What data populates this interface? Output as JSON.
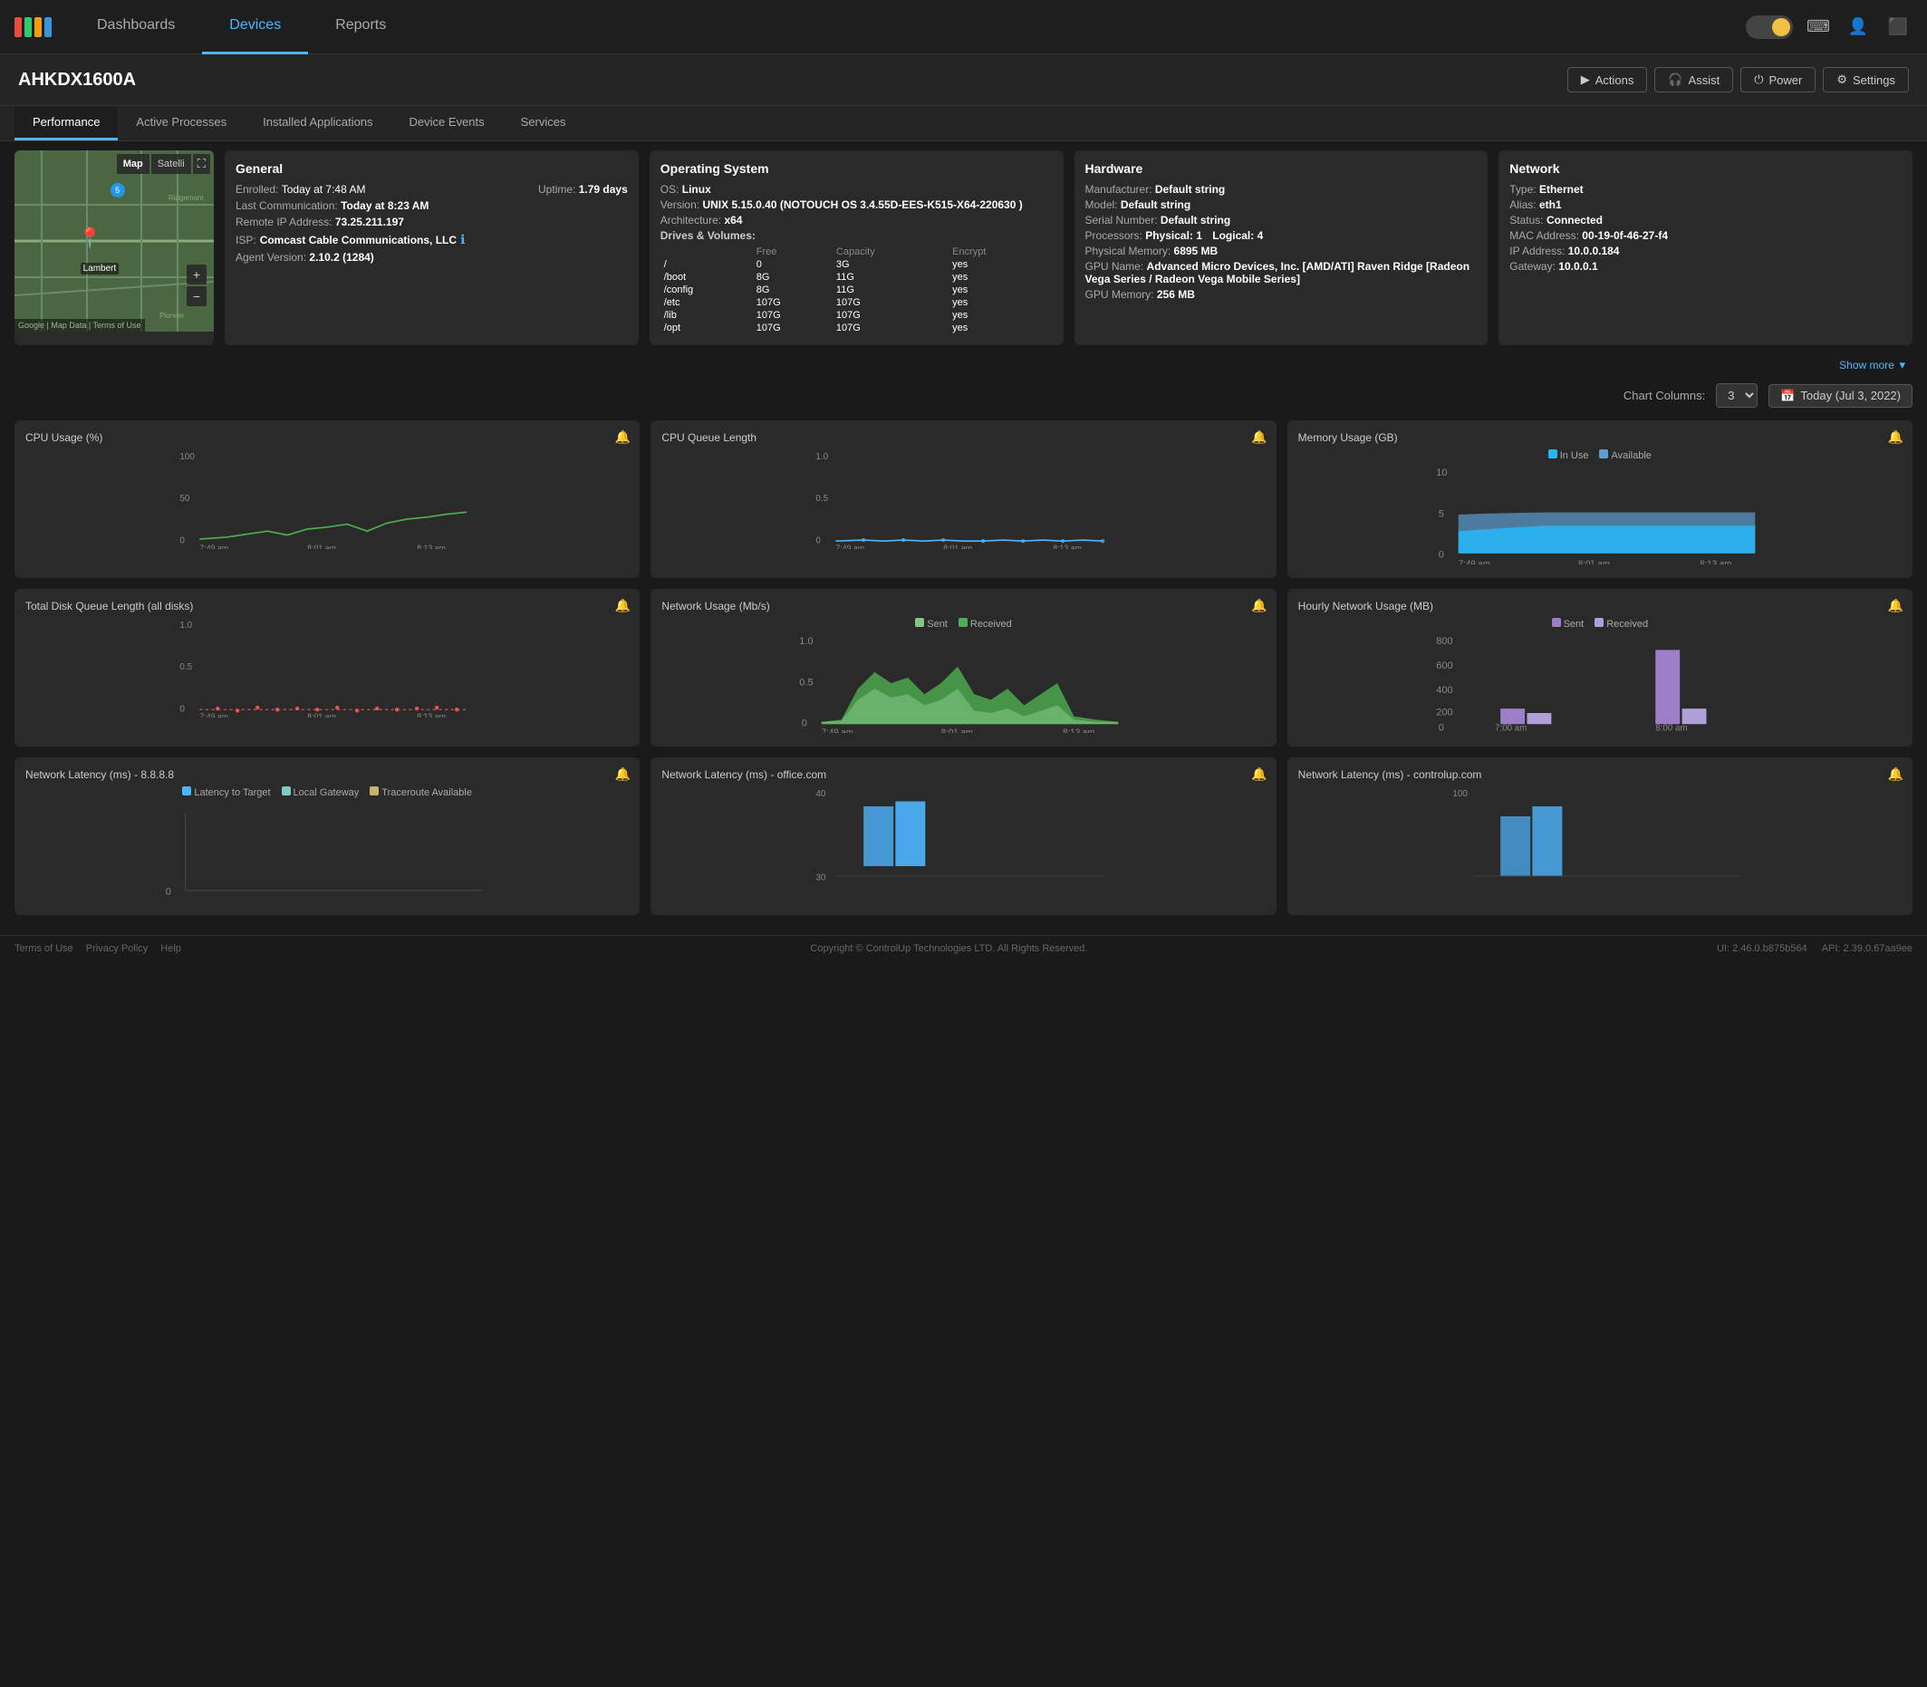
{
  "nav": {
    "links": [
      "Dashboards",
      "Devices",
      "Reports"
    ],
    "active": "Devices"
  },
  "device": {
    "title": "AHKDX1600A",
    "actions": [
      "Actions",
      "Assist",
      "Power",
      "Settings"
    ]
  },
  "tabs": {
    "items": [
      "Performance",
      "Active Processes",
      "Installed Applications",
      "Device Events",
      "Services"
    ],
    "active": "Performance"
  },
  "general": {
    "heading": "General",
    "enrolled_label": "Enrolled:",
    "enrolled_value": "Today at 7:48 AM",
    "uptime_label": "Uptime:",
    "uptime_value": "1.79 days",
    "last_comm_label": "Last Communication:",
    "last_comm_value": "Today at 8:23 AM",
    "remote_ip_label": "Remote IP Address:",
    "remote_ip_value": "73.25.211.197",
    "isp_label": "ISP:",
    "isp_value": "Comcast Cable Communications, LLC",
    "agent_label": "Agent Version:",
    "agent_value": "2.10.2 (1284)"
  },
  "os": {
    "heading": "Operating System",
    "os_label": "OS:",
    "os_value": "Linux",
    "version_label": "Version:",
    "version_value": "UNIX 5.15.0.40 (NOTOUCH OS 3.4.55D-EES-K515-X64-220630 )",
    "arch_label": "Architecture:",
    "arch_value": "x64",
    "drives_heading": "Drives & Volumes:",
    "drives_cols": [
      "",
      "Free",
      "Capacity",
      "Encrypt"
    ],
    "drives": [
      {
        "name": "/",
        "free": "0",
        "capacity": "3G",
        "encrypt": "yes"
      },
      {
        "name": "/boot",
        "free": "8G",
        "capacity": "11G",
        "encrypt": "yes"
      },
      {
        "name": "/config",
        "free": "8G",
        "capacity": "11G",
        "encrypt": "yes"
      },
      {
        "name": "/etc",
        "free": "107G",
        "capacity": "107G",
        "encrypt": "yes"
      },
      {
        "name": "/lib",
        "free": "107G",
        "capacity": "107G",
        "encrypt": "yes"
      },
      {
        "name": "/opt",
        "free": "107G",
        "capacity": "107G",
        "encrypt": "yes"
      }
    ]
  },
  "hardware": {
    "heading": "Hardware",
    "manufacturer_label": "Manufacturer:",
    "manufacturer_value": "Default string",
    "model_label": "Model:",
    "model_value": "Default string",
    "serial_label": "Serial Number:",
    "serial_value": "Default string",
    "processors_label": "Processors:",
    "processors_physical": "Physical: 1",
    "processors_logical": "Logical: 4",
    "memory_label": "Physical Memory:",
    "memory_value": "6895 MB",
    "gpu_label": "GPU Name:",
    "gpu_value": "Advanced Micro Devices, Inc. [AMD/ATI] Raven Ridge [Radeon Vega Series / Radeon Vega Mobile Series]",
    "gpu_memory_label": "GPU Memory:",
    "gpu_memory_value": "256 MB"
  },
  "network": {
    "heading": "Network",
    "type_label": "Type:",
    "type_value": "Ethernet",
    "alias_label": "Alias:",
    "alias_value": "eth1",
    "status_label": "Status:",
    "status_value": "Connected",
    "mac_label": "MAC Address:",
    "mac_value": "00-19-0f-46-27-f4",
    "ip_label": "IP Address:",
    "ip_value": "10.0.0.184",
    "gateway_label": "Gateway:",
    "gateway_value": "10.0.0.1"
  },
  "show_more": "Show more",
  "chart_controls": {
    "columns_label": "Chart Columns:",
    "columns_value": "3",
    "date_value": "Today (Jul 3, 2022)"
  },
  "charts": [
    {
      "title": "CPU Usage (%)",
      "y_max": "100",
      "y_mid": "50",
      "y_min": "0",
      "x_labels": [
        "7:49 am",
        "8:01 am",
        "8:13 am"
      ],
      "color": "#4caf50",
      "type": "line"
    },
    {
      "title": "CPU Queue Length",
      "y_max": "1.0",
      "y_mid": "0.5",
      "y_min": "0",
      "x_labels": [
        "7:49 am",
        "8:01 am",
        "8:13 am"
      ],
      "color": "#4db6ff",
      "type": "line_flat"
    },
    {
      "title": "Memory Usage (GB)",
      "y_max": "10",
      "y_mid": "5",
      "y_min": "0",
      "x_labels": [
        "7:49 am",
        "8:01 am",
        "8:13 am"
      ],
      "legend": [
        {
          "label": "In Use",
          "color": "#29b6f6"
        },
        {
          "label": "Available",
          "color": "#5c9ecf"
        }
      ],
      "type": "area_dual"
    },
    {
      "title": "Total Disk Queue Length (all disks)",
      "y_max": "1.0",
      "y_mid": "0.5",
      "y_min": "0",
      "x_labels": [
        "7:49 am",
        "8:01 am",
        "8:13 am"
      ],
      "color": "#ef5350",
      "type": "line_dots"
    },
    {
      "title": "Network Usage (Mb/s)",
      "y_max": "1.0",
      "y_mid": "0.5",
      "y_min": "0",
      "x_labels": [
        "7:49 am",
        "8:01 am",
        "8:13 am"
      ],
      "legend": [
        {
          "label": "Sent",
          "color": "#81c784"
        },
        {
          "label": "Received",
          "color": "#4caf50"
        }
      ],
      "type": "area_network"
    },
    {
      "title": "Hourly Network Usage (MB)",
      "y_max": "800",
      "y_mid": "400",
      "y_min": "0",
      "x_labels": [
        "7:00 am",
        "8:00 am"
      ],
      "legend": [
        {
          "label": "Sent",
          "color": "#9c7fc8"
        },
        {
          "label": "Received",
          "color": "#b0a0d8"
        }
      ],
      "type": "bar_dual"
    },
    {
      "title": "Network Latency (ms) - 8.8.8.8",
      "y_max": "",
      "y_mid": "",
      "y_min": "",
      "x_labels": [],
      "legend": [
        {
          "label": "Latency to Target",
          "color": "#4db6ff"
        },
        {
          "label": "Local Gateway",
          "color": "#80cbc4"
        },
        {
          "label": "Traceroute Available",
          "color": "#c8b56a"
        }
      ],
      "type": "latency"
    },
    {
      "title": "Network Latency (ms) - office.com",
      "y_max": "40",
      "y_mid": "",
      "y_min": "30",
      "x_labels": [],
      "legend": [],
      "type": "latency_bar"
    },
    {
      "title": "Network Latency (ms) - controlup.com",
      "y_max": "100",
      "y_mid": "",
      "y_min": "",
      "x_labels": [],
      "legend": [],
      "type": "latency_bar2"
    }
  ],
  "footer": {
    "links": [
      "Terms of Use",
      "Privacy Policy",
      "Help"
    ],
    "copyright": "Copyright © ControlUp Technologies LTD. All Rights Reserved.",
    "ui_version": "UI: 2.46.0.b875b564",
    "api_version": "API: 2.39.0.67aa9ee"
  }
}
